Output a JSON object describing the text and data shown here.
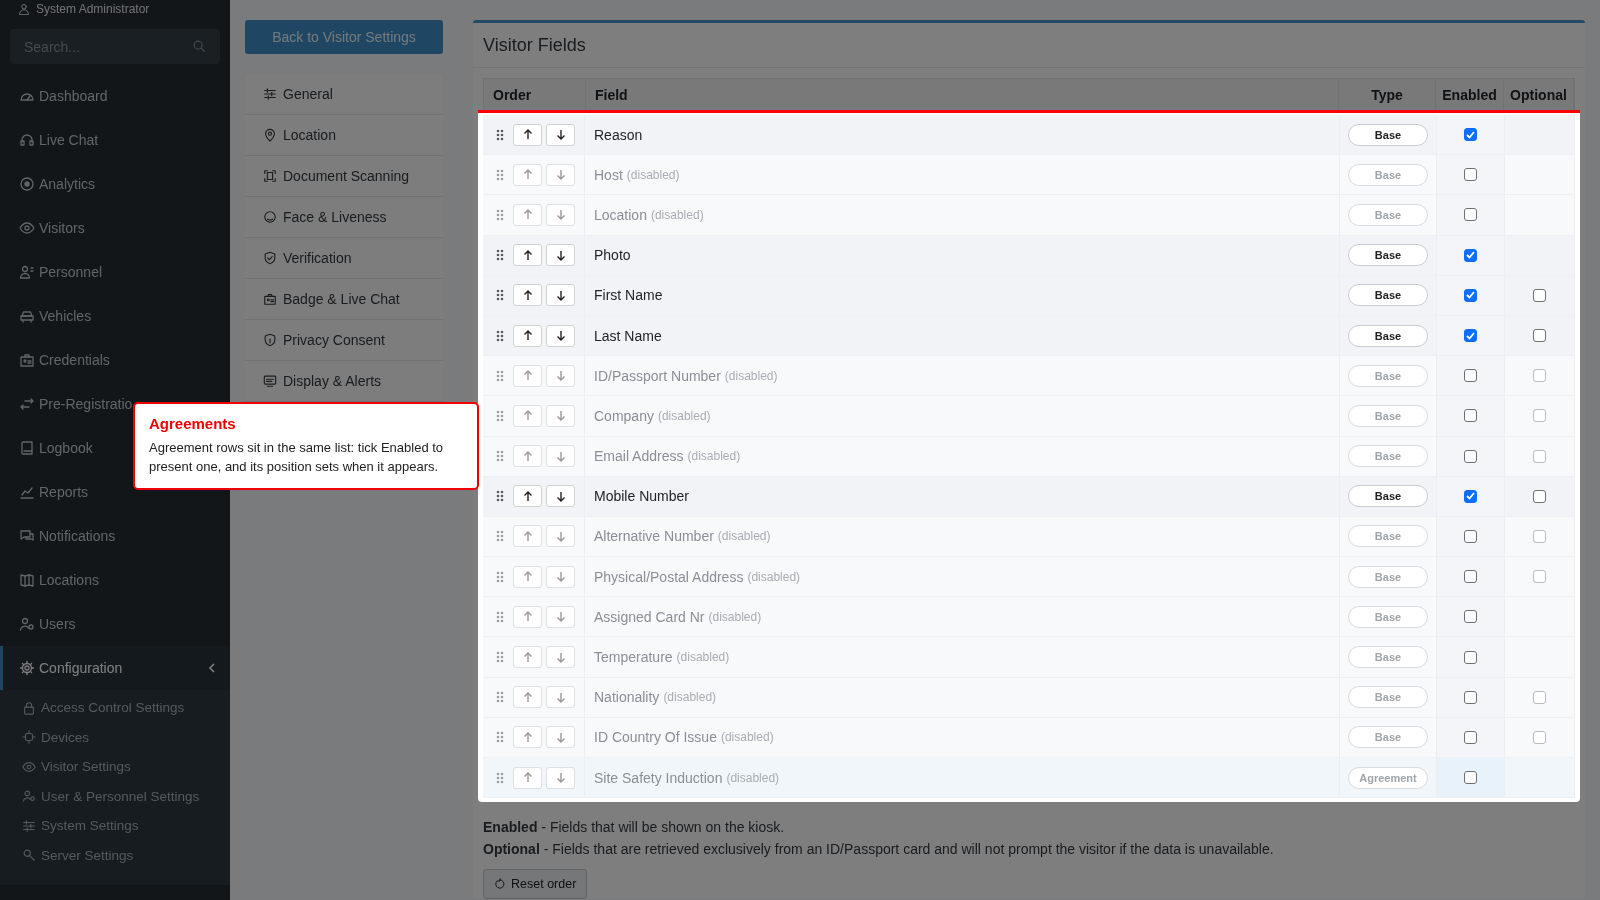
{
  "user": {
    "name": "System Administrator"
  },
  "search": {
    "placeholder": "Search..."
  },
  "nav": [
    {
      "label": "Dashboard",
      "selected": false
    },
    {
      "label": "Live Chat",
      "selected": false
    },
    {
      "label": "Analytics",
      "selected": false
    },
    {
      "label": "Visitors",
      "selected": false
    },
    {
      "label": "Personnel",
      "selected": false
    },
    {
      "label": "Vehicles",
      "selected": false
    },
    {
      "label": "Credentials",
      "selected": false
    },
    {
      "label": "Pre-Registratio",
      "selected": false
    },
    {
      "label": "Logbook",
      "selected": false
    },
    {
      "label": "Reports",
      "selected": false
    },
    {
      "label": "Notifications",
      "selected": false
    },
    {
      "label": "Locations",
      "selected": false
    },
    {
      "label": "Users",
      "selected": false
    },
    {
      "label": "Configuration",
      "selected": true,
      "expanded": true,
      "children": [
        {
          "label": "Access Control Settings",
          "selected": false
        },
        {
          "label": "Devices",
          "selected": false
        },
        {
          "label": "Visitor Settings",
          "selected": false
        },
        {
          "label": "User & Personnel Settings",
          "selected": false
        },
        {
          "label": "System Settings",
          "selected": false
        },
        {
          "label": "Server Settings",
          "selected": false
        }
      ]
    }
  ],
  "back_button": "Back to Visitor Settings",
  "sections": [
    {
      "label": "General"
    },
    {
      "label": "Location"
    },
    {
      "label": "Document Scanning"
    },
    {
      "label": "Face & Liveness"
    },
    {
      "label": "Verification"
    },
    {
      "label": "Badge & Live Chat"
    },
    {
      "label": "Privacy Consent"
    },
    {
      "label": "Display & Alerts"
    }
  ],
  "card": {
    "title": "Visitor Fields",
    "columns": [
      "Order",
      "Field",
      "Type",
      "Enabled",
      "Optional"
    ],
    "rows": [
      {
        "field": "Reason",
        "type": "Base",
        "kind": "base",
        "enabled": true
      },
      {
        "field": "Host",
        "note": "(disabled)",
        "type": "Base",
        "kind": "base",
        "enabled": false
      },
      {
        "field": "Location",
        "note": "(disabled)",
        "type": "Base",
        "kind": "base",
        "enabled": false
      },
      {
        "field": "Photo",
        "type": "Base",
        "kind": "base",
        "enabled": true
      },
      {
        "field": "First Name",
        "type": "Base",
        "kind": "base",
        "enabled": true,
        "optional": false
      },
      {
        "field": "Last Name",
        "type": "Base",
        "kind": "base",
        "enabled": true,
        "optional": false
      },
      {
        "field": "ID/Passport Number",
        "note": "(disabled)",
        "type": "Base",
        "kind": "base",
        "enabled": false,
        "optional": false
      },
      {
        "field": "Company",
        "note": "(disabled)",
        "type": "Base",
        "kind": "base",
        "enabled": false,
        "optional": false
      },
      {
        "field": "Email Address",
        "note": "(disabled)",
        "type": "Base",
        "kind": "base",
        "enabled": false,
        "optional": false
      },
      {
        "field": "Mobile Number",
        "type": "Base",
        "kind": "base",
        "enabled": true,
        "optional": false
      },
      {
        "field": "Alternative Number",
        "note": "(disabled)",
        "type": "Base",
        "kind": "base",
        "enabled": false,
        "optional": false
      },
      {
        "field": "Physical/Postal Address",
        "note": "(disabled)",
        "type": "Base",
        "kind": "base",
        "enabled": false,
        "optional": false
      },
      {
        "field": "Assigned Card Nr",
        "note": "(disabled)",
        "type": "Base",
        "kind": "base",
        "enabled": false
      },
      {
        "field": "Temperature",
        "note": "(disabled)",
        "type": "Base",
        "kind": "base",
        "enabled": false
      },
      {
        "field": "Nationality",
        "note": "(disabled)",
        "type": "Base",
        "kind": "base",
        "enabled": false,
        "optional": false
      },
      {
        "field": "ID Country Of Issue",
        "note": "(disabled)",
        "type": "Base",
        "kind": "base",
        "enabled": false,
        "optional": false
      },
      {
        "field": "Site Safety Induction",
        "note": "(disabled)",
        "type": "Agreement",
        "kind": "agreement",
        "enabled": false
      }
    ],
    "notes": [
      "**Enabled** - Fields that will be shown on the kiosk.",
      "**Optional** - Fields that are retrieved exclusively from an ID/Passport card and will not prompt the visitor if the data is unavailable."
    ],
    "reset_button": "Reset order"
  },
  "tooltip": {
    "title": "Agreements",
    "text": "Agreement rows sit in the same list: tick Enabled to present one, and its position sets when it appears."
  }
}
